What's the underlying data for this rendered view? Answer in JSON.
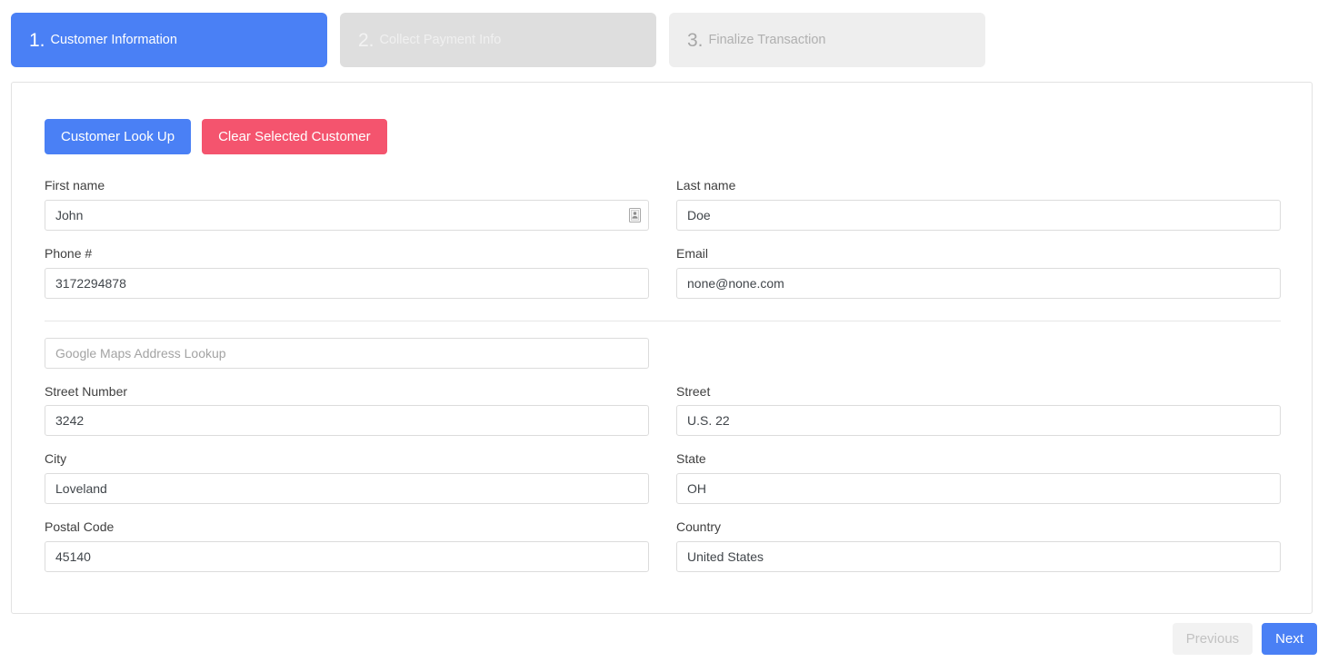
{
  "steps": [
    {
      "num": "1.",
      "label": "Customer Information",
      "state": "active",
      "color": "#4a80f5"
    },
    {
      "num": "2.",
      "label": "Collect Payment Info",
      "state": "inactive",
      "color": "#dedede"
    },
    {
      "num": "3.",
      "label": "Finalize Transaction",
      "state": "inactive",
      "color": "#eeeeee"
    }
  ],
  "actions": {
    "lookup_label": "Customer Look Up",
    "lookup_color": "#4a80f5",
    "clear_label": "Clear Selected Customer",
    "clear_color": "#f4546e"
  },
  "form": {
    "first_name": {
      "label": "First name",
      "value": "John",
      "placeholder": "",
      "icon": "contact-card-icon"
    },
    "last_name": {
      "label": "Last name",
      "value": "Doe",
      "placeholder": ""
    },
    "phone": {
      "label": "Phone #",
      "value": "3172294878",
      "placeholder": ""
    },
    "email": {
      "label": "Email",
      "value": "none@none.com",
      "placeholder": ""
    },
    "address_lookup": {
      "label": "",
      "value": "",
      "placeholder": "Google Maps Address Lookup"
    },
    "street_number": {
      "label": "Street Number",
      "value": "3242",
      "placeholder": ""
    },
    "street": {
      "label": "Street",
      "value": "U.S. 22",
      "placeholder": ""
    },
    "city": {
      "label": "City",
      "value": "Loveland",
      "placeholder": ""
    },
    "state": {
      "label": "State",
      "value": "OH",
      "placeholder": ""
    },
    "postal_code": {
      "label": "Postal Code",
      "value": "45140",
      "placeholder": ""
    },
    "country": {
      "label": "Country",
      "value": "United States",
      "placeholder": ""
    }
  },
  "footer": {
    "previous_label": "Previous",
    "next_label": "Next",
    "next_color": "#4a80f5"
  }
}
